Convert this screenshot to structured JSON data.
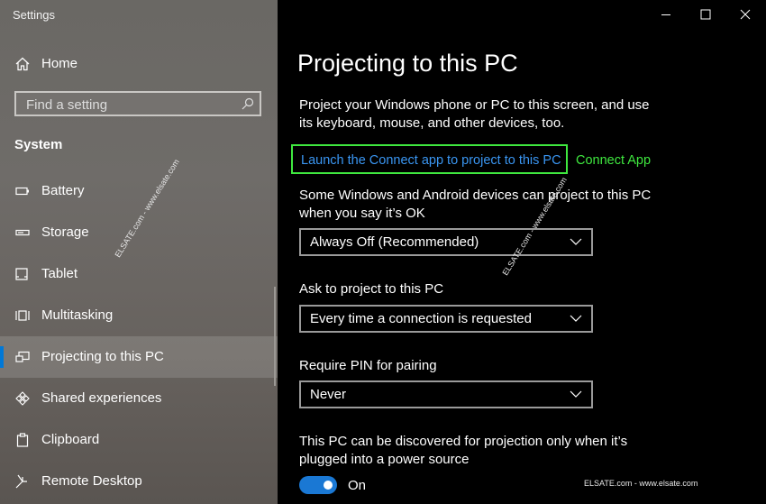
{
  "app": {
    "title": "Settings"
  },
  "sidebar": {
    "home_label": "Home",
    "search_placeholder": "Find a setting",
    "section": "System",
    "items": [
      {
        "label": "Battery",
        "icon": "battery-icon"
      },
      {
        "label": "Storage",
        "icon": "storage-icon"
      },
      {
        "label": "Tablet",
        "icon": "tablet-icon"
      },
      {
        "label": "Multitasking",
        "icon": "multitasking-icon"
      },
      {
        "label": "Projecting to this PC",
        "icon": "projecting-icon",
        "active": true
      },
      {
        "label": "Shared experiences",
        "icon": "shared-experiences-icon"
      },
      {
        "label": "Clipboard",
        "icon": "clipboard-icon"
      },
      {
        "label": "Remote Desktop",
        "icon": "remote-desktop-icon"
      }
    ]
  },
  "main": {
    "title": "Projecting to this PC",
    "intro": "Project your Windows phone or PC to this screen, and use its keyboard, mouse, and other devices, too.",
    "connect_link": "Launch the Connect app to project to this PC",
    "connect_note": "Connect App",
    "allow_label": "Some Windows and Android devices can project to this PC when you say it’s OK",
    "allow_value": "Always Off (Recommended)",
    "ask_label": "Ask to project to this PC",
    "ask_value": "Every time a connection is requested",
    "pin_label": "Require PIN for pairing",
    "pin_value": "Never",
    "discover_label": "This PC can be discovered for projection only when it’s plugged into a power source",
    "discover_toggle_label": "On",
    "discover_toggle_on": true
  },
  "watermarks": {
    "sidebar": "ELSATE.com - www.elsate.com",
    "main": "ELSATE.com - www.elsate.com",
    "bottom": "ELSATE.com - www.elsate.com"
  },
  "colors": {
    "accent": "#0078d7",
    "link": "#3a96f2",
    "highlight": "#3fe83f",
    "main_bg": "#000000",
    "sidebar_bg": "#6b6865"
  }
}
